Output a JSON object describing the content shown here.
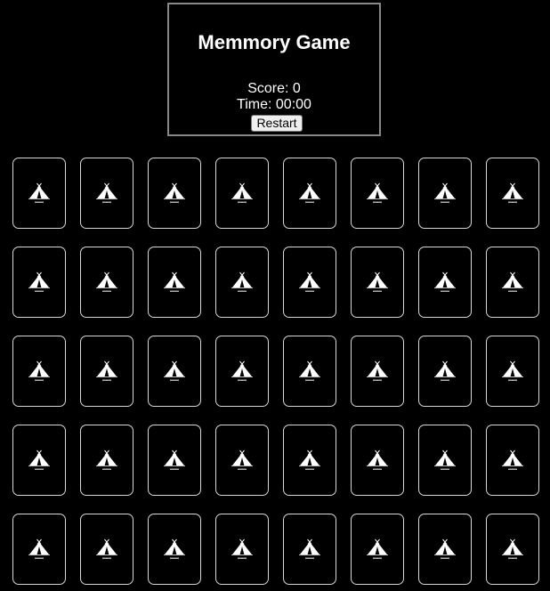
{
  "header": {
    "title": "Memmory Game",
    "score_label": "Score: 0",
    "time_label": "Time: 00:00",
    "restart_label": "Restart"
  },
  "board": {
    "rows": 5,
    "columns": 8,
    "card_back_icon": "tent-icon",
    "card_count": 40
  },
  "colors": {
    "background": "#000000",
    "text": "#ffffff",
    "card_border": "#d8d8d8",
    "header_border": "#888888"
  }
}
